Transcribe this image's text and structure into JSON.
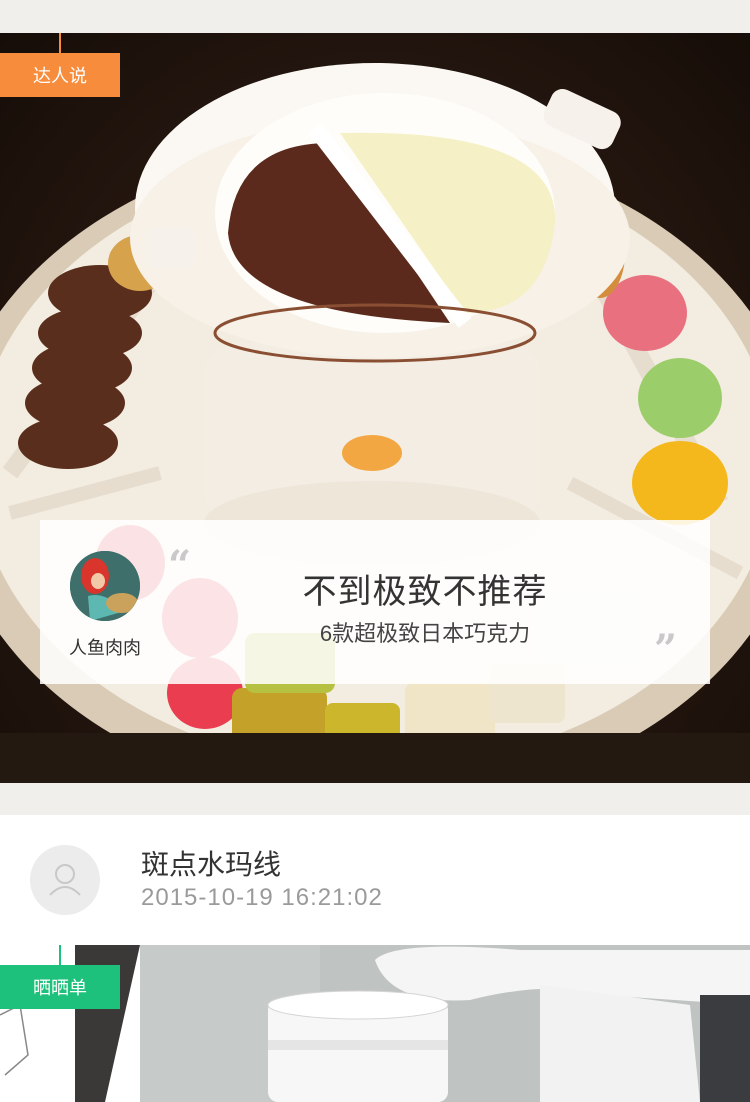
{
  "card1": {
    "tag_label": "达人说",
    "tag_color": "#f78c3c",
    "author_name": "人鱼肉肉",
    "quote_open": "“",
    "quote_close": "”",
    "headline": "不到极致不推荐",
    "subline": "6款超极致日本巧克力"
  },
  "post": {
    "user_name": "斑点水玛线",
    "timestamp": "2015-10-19 16:21:02"
  },
  "card2": {
    "tag_label": "晒晒单",
    "tag_color": "#1dc17c"
  },
  "colors": {
    "page_bg": "#f0efeb",
    "card_bg": "#ffffff",
    "text_primary": "#333333",
    "text_muted": "#9a9a9a"
  }
}
